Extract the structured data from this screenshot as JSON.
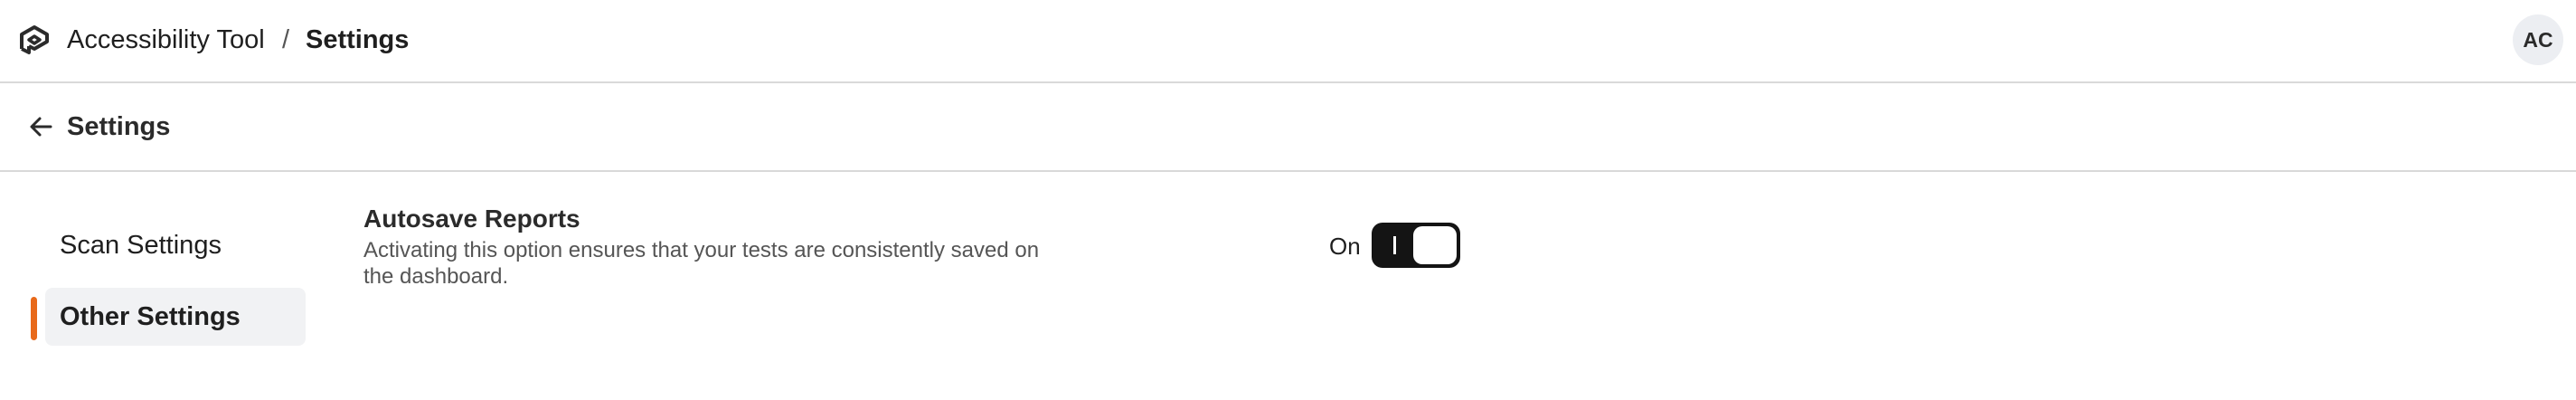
{
  "header": {
    "app_name": "Accessibility Tool",
    "separator": "/",
    "current": "Settings",
    "avatar_initials": "AC"
  },
  "page": {
    "title": "Settings"
  },
  "sidebar": {
    "items": [
      {
        "label": "Scan Settings",
        "active": false
      },
      {
        "label": "Other Settings",
        "active": true
      }
    ],
    "active_indicator_color": "#e8691a"
  },
  "settings": {
    "autosave": {
      "title": "Autosave Reports",
      "description": "Activating this option ensures that your tests are consistently saved on the dashboard.",
      "state_label": "On",
      "enabled": true
    }
  }
}
